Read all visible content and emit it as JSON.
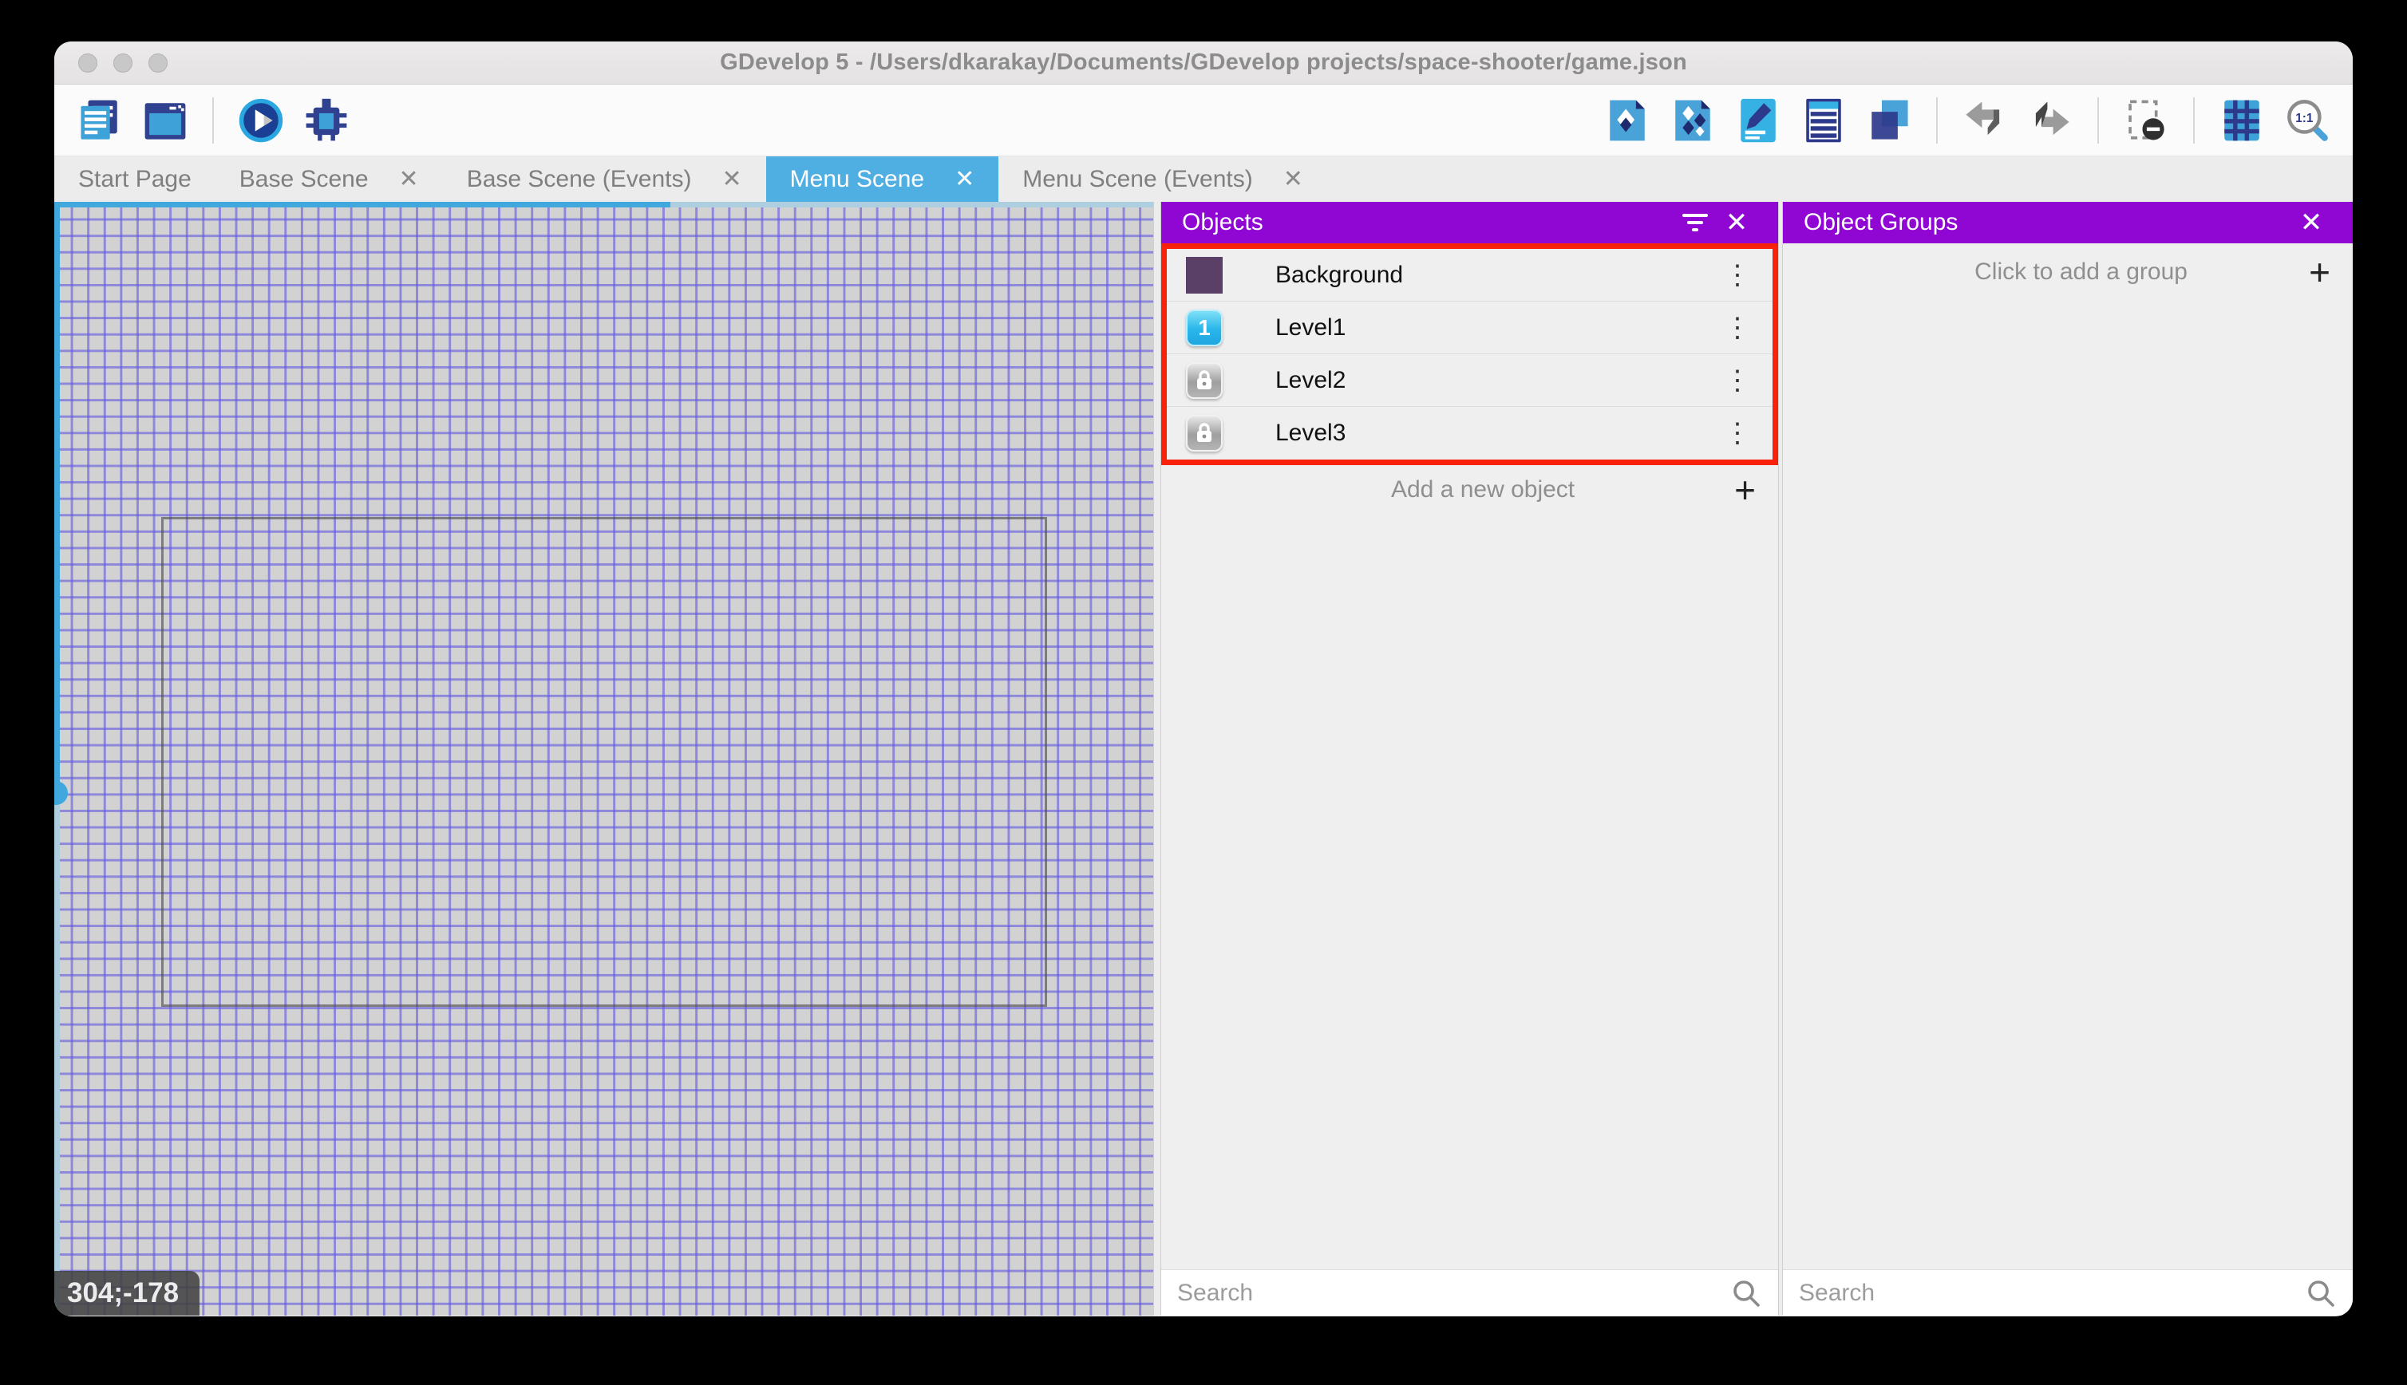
{
  "window": {
    "title": "GDevelop 5 - /Users/dkarakay/Documents/GDevelop projects/space-shooter/game.json"
  },
  "toolbar": {
    "left_icons": [
      "project-manager-icon",
      "scene-window-icon",
      "play-icon",
      "debug-icon"
    ],
    "right_icons": [
      "objects-editor-icon",
      "object-groups-icon",
      "properties-icon",
      "instances-list-icon",
      "layers-icon",
      "undo-icon",
      "redo-icon",
      "window-mask-icon",
      "grid-icon",
      "zoom-1-1-icon"
    ]
  },
  "tabs": [
    {
      "label": "Start Page",
      "closable": false,
      "active": false
    },
    {
      "label": "Base Scene",
      "closable": true,
      "active": false
    },
    {
      "label": "Base Scene (Events)",
      "closable": true,
      "active": false
    },
    {
      "label": "Menu Scene",
      "closable": true,
      "active": true
    },
    {
      "label": "Menu Scene (Events)",
      "closable": true,
      "active": false
    }
  ],
  "canvas": {
    "coordinates_badge": "304;-178"
  },
  "objects_panel": {
    "title": "Objects",
    "items": [
      {
        "name": "Background",
        "icon": "background-thumbnail"
      },
      {
        "name": "Level1",
        "icon": "level1-number-button"
      },
      {
        "name": "Level2",
        "icon": "locked-button"
      },
      {
        "name": "Level3",
        "icon": "locked-button"
      }
    ],
    "level1_glyph": "1",
    "add_label": "Add a new object",
    "search_placeholder": "Search"
  },
  "groups_panel": {
    "title": "Object Groups",
    "empty_label": "Click to add a group",
    "search_placeholder": "Search"
  },
  "ui": {
    "close_glyph": "✕",
    "plus_glyph": "+",
    "kebab_glyph": "⋮"
  },
  "colors": {
    "accent_purple": "#9007d4",
    "active_tab_blue": "#4fafe3",
    "highlight_red": "#f8220b",
    "grid_line": "#645ae0",
    "canvas_bg": "#d2d2d2"
  }
}
